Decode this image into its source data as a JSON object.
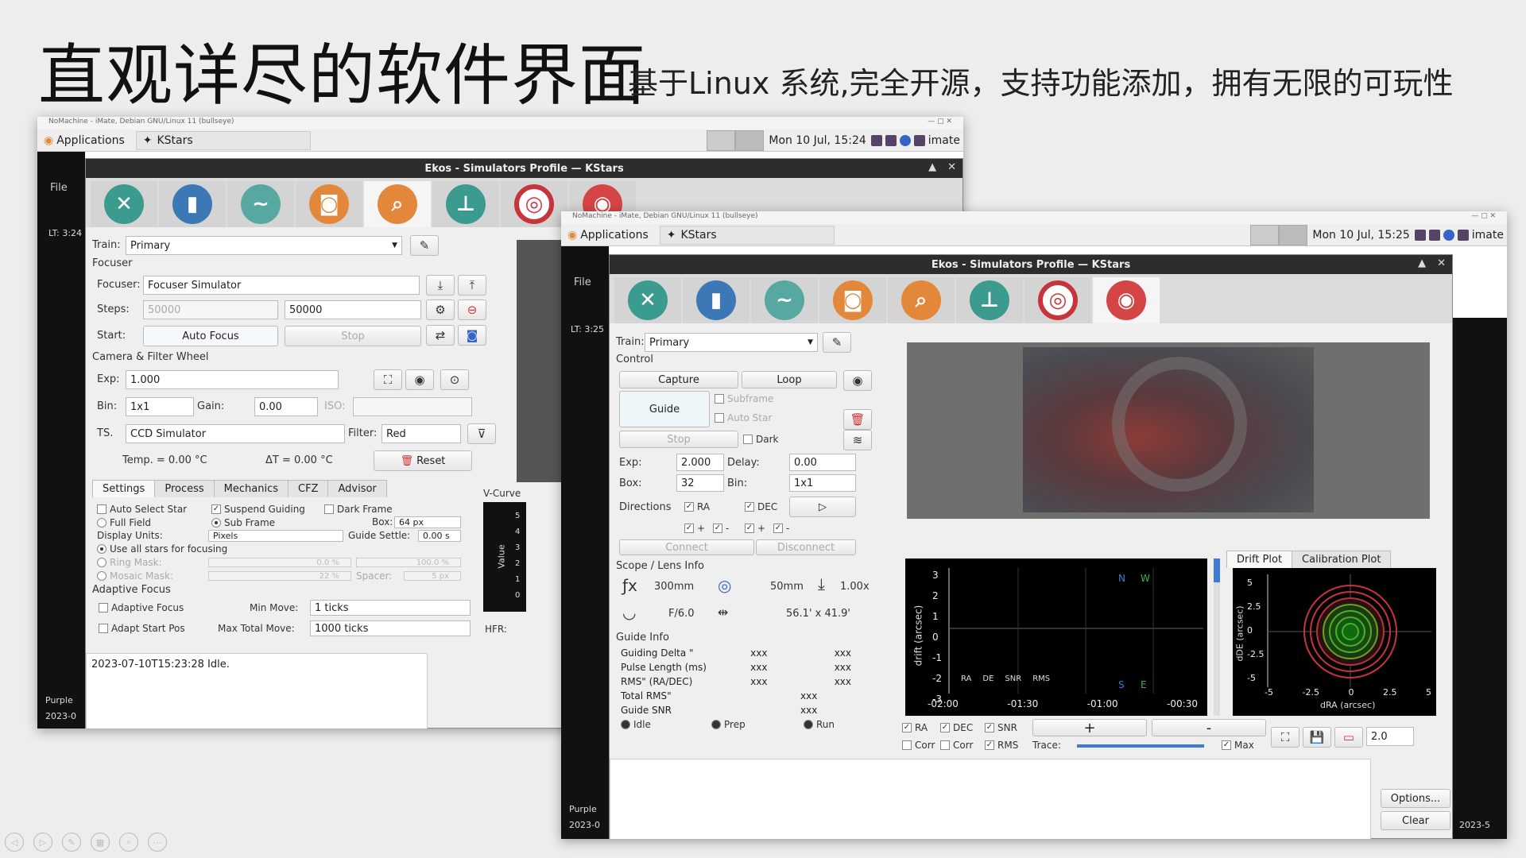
{
  "slide": {
    "title": "直观详尽的软件界面",
    "subtitle": "基于Linux 系统,完全开源，支持功能添加，拥有无限的可玩性"
  },
  "left": {
    "nomachine_title": "NoMachine - iMate, Debian GNU/Linux 11 (bullseye)",
    "panel": {
      "applications": "Applications",
      "task": "KStars",
      "clock": "Mon 10 Jul, 15:24",
      "user": "imate"
    },
    "kstars_menu": "File",
    "lt_label": "LT: 3:24",
    "purple_label": "Purple",
    "year_label": "2023-0",
    "ekos_title": "Ekos - Simulators Profile — KStars",
    "train_label": "Train:",
    "train_value": "Primary",
    "focuser_section": "Focuser",
    "focuser_label": "Focuser:",
    "focuser_value": "Focuser Simulator",
    "steps_label": "Steps:",
    "steps_value1": "50000",
    "steps_value2": "50000",
    "start_label": "Start:",
    "auto_focus": "Auto Focus",
    "stop": "Stop",
    "camera_section": "Camera & Filter Wheel",
    "exp_label": "Exp:",
    "exp_value": "1.000",
    "bin_label": "Bin:",
    "bin_value": "1x1",
    "gain_label": "Gain:",
    "gain_value": "0.00",
    "iso_label": "ISO:",
    "ts_label": "TS.",
    "camera_value": "CCD Simulator",
    "filter_label": "Filter:",
    "filter_value": "Red",
    "temp_text": "Temp. = 0.00 °C",
    "dt_text": "ΔT = 0.00 °C",
    "reset": "Reset",
    "tabs": [
      "Settings",
      "Process",
      "Mechanics",
      "CFZ",
      "Advisor"
    ],
    "auto_select_star": "Auto Select Star",
    "suspend_guiding": "Suspend Guiding",
    "dark_frame": "Dark Frame",
    "full_field": "Full Field",
    "sub_frame": "Sub Frame",
    "box_label": "Box:",
    "box_value": "64 px",
    "display_units": "Display Units:",
    "pixels": "Pixels",
    "guide_settle": "Guide Settle:",
    "guide_settle_value": "0.00 s",
    "use_all_stars": "Use all stars for focusing",
    "ring_mask": "Ring Mask:",
    "ring_mask_v1": "0.0 %",
    "ring_mask_v2": "100.0 %",
    "mosaic_mask": "Mosaic Mask:",
    "mosaic_value": "22 %",
    "spacer_label": "Spacer:",
    "spacer_value": "5 px",
    "adaptive_section": "Adaptive Focus",
    "adaptive_focus": "Adaptive Focus",
    "min_move": "Min Move:",
    "min_move_value": "1 ticks",
    "adapt_start": "Adapt Start Pos",
    "max_total": "Max Total Move:",
    "max_total_value": "1000 ticks",
    "vcurve": "V-Curve",
    "value_label": "Value",
    "vcurve_ticks": [
      "5",
      "4",
      "3",
      "2",
      "1",
      "0"
    ],
    "hfr": "HFR:",
    "log": "2023-07-10T15:23:28 Idle."
  },
  "right": {
    "nomachine_title": "NoMachine - iMate, Debian GNU/Linux 11 (bullseye)",
    "panel": {
      "applications": "Applications",
      "task": "KStars",
      "clock": "Mon 10 Jul, 15:25",
      "user": "imate"
    },
    "kstars_menu": "File",
    "lt_label": "LT: 3:25",
    "purple_label": "Purple",
    "year_label": "2023-0",
    "year_label2": "2023-5",
    "ekos_title": "Ekos - Simulators Profile — KStars",
    "train_label": "Train:",
    "train_value": "Primary",
    "control_section": "Control",
    "capture": "Capture",
    "loop": "Loop",
    "guide": "Guide",
    "subframe": "Subframe",
    "auto_star": "Auto Star",
    "stop": "Stop",
    "dark": "Dark",
    "exp_label": "Exp:",
    "exp_value": "2.000",
    "delay_label": "Delay:",
    "delay_value": "0.00",
    "box_label": "Box:",
    "box_value": "32",
    "bin_label": "Bin:",
    "bin_value": "1x1",
    "directions": "Directions",
    "ra": "RA",
    "dec": "DEC",
    "plus": "+",
    "minus": "-",
    "connect": "Connect",
    "disconnect": "Disconnect",
    "scope_section": "Scope / Lens Info",
    "focal": "300mm",
    "aperture": "50mm",
    "factor": "1.00x",
    "fratio": "F/6.0",
    "fov": "56.1' x 41.9'",
    "guide_info": "Guide Info",
    "info_rows": [
      {
        "label": "Guiding Delta \"",
        "a": "xxx",
        "b": "xxx"
      },
      {
        "label": "Pulse Length (ms)",
        "a": "xxx",
        "b": "xxx"
      },
      {
        "label": "RMS\" (RA/DEC)",
        "a": "xxx",
        "b": "xxx"
      },
      {
        "label": "Total RMS\"",
        "a": "xxx",
        "b": ""
      },
      {
        "label": "Guide SNR",
        "a": "xxx",
        "b": ""
      }
    ],
    "idle": "Idle",
    "prep": "Prep",
    "run": "Run",
    "drift_tab": "Drift Plot",
    "calib_tab": "Calibration Plot",
    "drift_ylabel": "drift (arcsec)",
    "drift_yticks": [
      "3",
      "2",
      "1",
      "0",
      "-1",
      "-2",
      "-3"
    ],
    "drift_xticks": [
      "-02:00",
      "-01:30",
      "-01:00",
      "-00:30"
    ],
    "drift_legend": [
      "RA",
      "DE",
      "SNR",
      "RMS"
    ],
    "compass": {
      "n": "N",
      "w": "W",
      "s": "S",
      "e": "E"
    },
    "scatter_ylabel": "dDE (arcsec)",
    "scatter_xlabel": "dRA (arcsec)",
    "scatter_yticks": [
      "5",
      "2.5",
      "0",
      "-2.5",
      "-5"
    ],
    "scatter_xticks": [
      "-5",
      "-2.5",
      "0",
      "2.5",
      "5"
    ],
    "chk_ra": "RA",
    "chk_dec": "DEC",
    "chk_snr": "SNR",
    "chk_corr1": "Corr",
    "chk_corr2": "Corr",
    "chk_rms": "RMS",
    "trace": "Trace:",
    "max": "Max",
    "zoom_value": "2.0",
    "options": "Options...",
    "clear": "Clear"
  },
  "colors": {
    "dark": "#2d2d2d",
    "accent_orange": "#e3883a",
    "nebula": "#7a3a36"
  }
}
